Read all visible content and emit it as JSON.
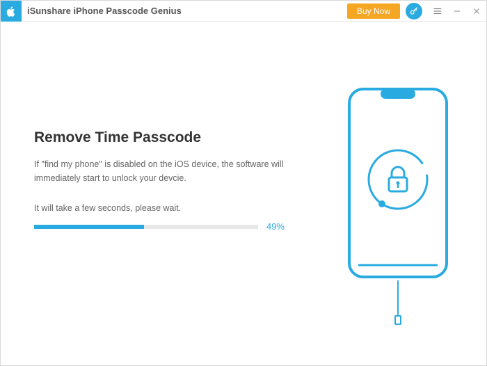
{
  "titlebar": {
    "app_title": "iSunshare iPhone Passcode Genius",
    "buy_label": "Buy Now"
  },
  "main": {
    "heading": "Remove Time Passcode",
    "description": "If \"find my phone\" is disabled on the iOS device, the software will immediately start to unlock your devcie.",
    "wait_text": "It will take a few seconds, please wait.",
    "progress_percent": 49,
    "progress_label": "49%"
  },
  "colors": {
    "accent": "#29abe2",
    "buy": "#f5a623"
  },
  "icons": {
    "app": "apple-icon",
    "key": "key-icon",
    "menu": "menu-icon",
    "minimize": "minimize-icon",
    "close": "close-icon",
    "lock": "lock-icon"
  }
}
